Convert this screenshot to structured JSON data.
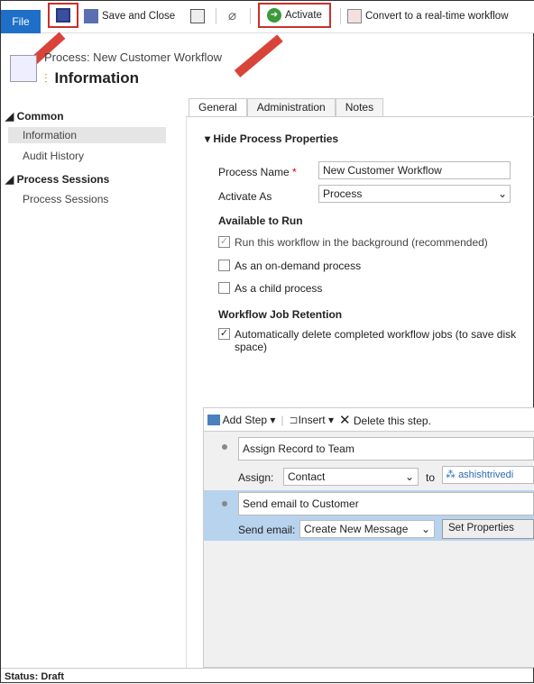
{
  "ribbon": {
    "file": "File",
    "save_close": "Save and Close",
    "activate": "Activate",
    "convert": "Convert to a real-time workflow"
  },
  "header": {
    "breadcrumb": "Process: New Customer Workflow",
    "title": "Information"
  },
  "sidebar": {
    "common": "Common",
    "items": [
      {
        "label": "Information"
      },
      {
        "label": "Audit History"
      }
    ],
    "sessions": "Process Sessions",
    "session_items": [
      {
        "label": "Process Sessions"
      }
    ]
  },
  "tabs": [
    {
      "label": "General"
    },
    {
      "label": "Administration"
    },
    {
      "label": "Notes"
    }
  ],
  "form": {
    "section": "Hide Process Properties",
    "name_label": "Process Name",
    "name_value": "New Customer Workflow",
    "activate_label": "Activate As",
    "activate_value": "Process",
    "available": "Available to Run",
    "opt1": "Run this workflow in the background (recommended)",
    "opt2": "As an on-demand process",
    "opt3": "As a child process",
    "retention": "Workflow Job Retention",
    "retention_opt": "Automatically delete completed workflow jobs (to save disk space)"
  },
  "steps": {
    "add_step": "Add Step",
    "insert": "Insert",
    "delete": "Delete this step.",
    "step1": {
      "title": "Assign Record to Team",
      "label": "Assign:",
      "value": "Contact",
      "to": "to",
      "owner": "ashishtrivedi"
    },
    "step2": {
      "title": "Send email to Customer",
      "label": "Send email:",
      "value": "Create New Message",
      "button": "Set Properties"
    }
  },
  "status": "Status: Draft",
  "colors": {
    "accent": "#1e6fc7",
    "highlight": "#c9302c",
    "selected_step": "#b8d3ee"
  }
}
